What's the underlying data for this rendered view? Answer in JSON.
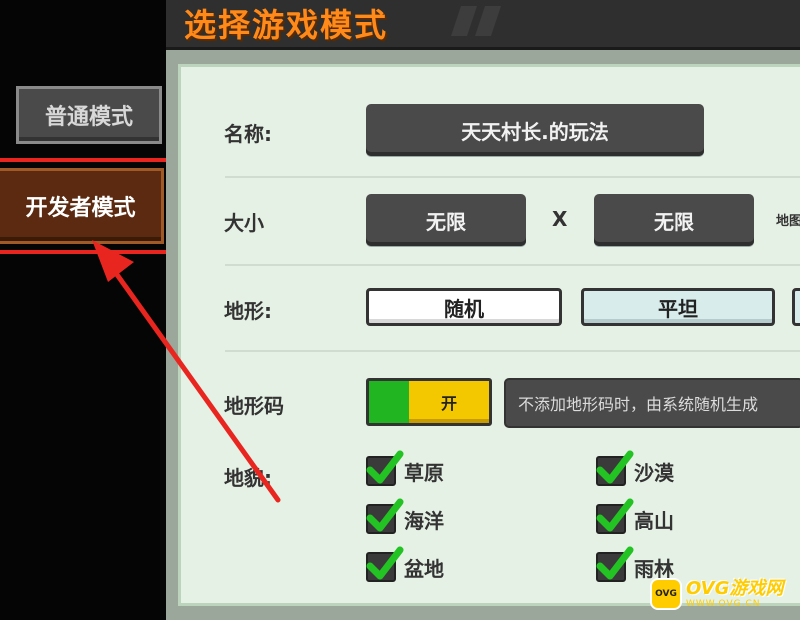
{
  "header": {
    "title": "选择游戏模式"
  },
  "modes": {
    "normal_label": "普通模式",
    "developer_label": "开发者模式"
  },
  "form": {
    "name": {
      "label": "名称:",
      "value": "天天村长.的玩法"
    },
    "size": {
      "label": "大小",
      "width": "无限",
      "separator": "X",
      "height": "无限",
      "edge_text": "地图"
    },
    "terrain": {
      "label": "地形:",
      "options": [
        "随机",
        "平坦"
      ]
    },
    "terrain_code": {
      "label": "地形码",
      "toggle_label": "开",
      "hint": "不添加地形码时，由系统随机生成"
    },
    "landform": {
      "label": "地貌:",
      "items": [
        "草原",
        "沙漠",
        "海洋",
        "高山",
        "盆地",
        "雨林"
      ]
    }
  },
  "watermark": {
    "logo": "OVG",
    "main": "OVG游戏网",
    "sub": "WWW.OVG.CN"
  },
  "colors": {
    "title_orange": "#ff8a1a",
    "annotation_red": "#e8261f",
    "check_green": "#22c322"
  }
}
